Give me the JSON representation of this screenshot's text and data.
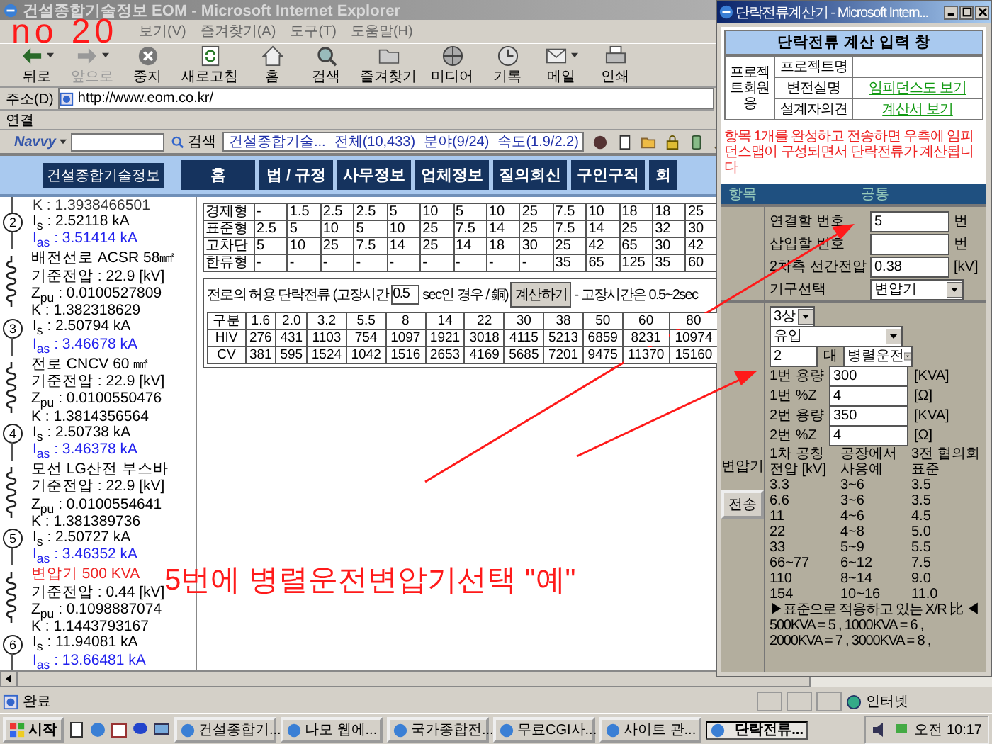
{
  "annotations": {
    "label": "no 20",
    "note": "5번에 병렬운전변압기선택 \"예\""
  },
  "browser": {
    "title": "건설종합기술정보 EOM - Microsoft Internet Explorer",
    "menu": [
      "보기(V)",
      "즐겨찾기(A)",
      "도구(T)",
      "도움말(H)"
    ],
    "toolbar": [
      {
        "label": "뒤로",
        "kind": "back",
        "disabled": false,
        "dropdown": true
      },
      {
        "label": "앞으로",
        "kind": "forward",
        "disabled": true,
        "dropdown": true
      },
      {
        "label": "중지",
        "kind": "stop",
        "disabled": false,
        "dropdown": false
      },
      {
        "label": "새로고침",
        "kind": "refresh",
        "disabled": false,
        "dropdown": false
      },
      {
        "label": "홈",
        "kind": "home",
        "disabled": false,
        "dropdown": false
      },
      {
        "label": "검색",
        "kind": "search",
        "disabled": false,
        "dropdown": false
      },
      {
        "label": "즐겨찾기",
        "kind": "favorites",
        "disabled": false,
        "dropdown": false
      },
      {
        "label": "미디어",
        "kind": "media",
        "disabled": false,
        "dropdown": false
      },
      {
        "label": "기록",
        "kind": "history",
        "disabled": false,
        "dropdown": false
      },
      {
        "label": "메일",
        "kind": "mail",
        "disabled": false,
        "dropdown": true
      },
      {
        "label": "인쇄",
        "kind": "print",
        "disabled": false,
        "dropdown": false
      }
    ],
    "address": {
      "label": "주소(D)",
      "value": "http://www.eom.co.kr/"
    },
    "links_label": "연결",
    "navvy": {
      "brand": "Navvy",
      "search_button": "검색",
      "site": "건설종합기술...",
      "stats": [
        "전체(10,433)",
        "분야(9/24)",
        "속도(1.9/2.2)"
      ]
    }
  },
  "site": {
    "logo": "건설종합기술정보",
    "nav": [
      "홈",
      "법 / 규정",
      "사무정보",
      "업체정보",
      "질의회신",
      "구인구직",
      "회"
    ]
  },
  "circuit": {
    "top_partial": "K : 1.3938466501",
    "nodes": [
      {
        "number": "2",
        "is": "I$_{s}$ : 2.52118 kA",
        "ias": "I$_{as}$ : 3.51414 kA",
        "desc": "배전선로 ACSR 58㎟",
        "desc_highlight": false,
        "voltage": "기준전압 : 22.9 [kV]",
        "zpu": "Z$_{pu}$ : 0.0100527809",
        "k": "K : 1.382318629"
      },
      {
        "number": "3",
        "is": "I$_{s}$ : 2.50794 kA",
        "ias": "I$_{as}$ : 3.46678 kA",
        "desc": "전로 CNCV 60 ㎟",
        "desc_highlight": false,
        "voltage": "기준전압 : 22.9 [kV]",
        "zpu": "Z$_{pu}$ : 0.0100550476",
        "k": "K : 1.3814356564"
      },
      {
        "number": "4",
        "is": "I$_{s}$ : 2.50738 kA",
        "ias": "I$_{as}$ : 3.46378 kA",
        "desc": "모선 LG산전 부스바",
        "desc_highlight": false,
        "voltage": "기준전압 : 22.9 [kV]",
        "zpu": "Z$_{pu}$ : 0.0100554641",
        "k": "K : 1.381389736"
      },
      {
        "number": "5",
        "is": "I$_{s}$ : 2.50727 kA",
        "ias": "I$_{as}$ : 3.46352 kA",
        "desc": "변압기 500 KVA",
        "desc_highlight": true,
        "voltage": "기준전압 : 0.44 [kV]",
        "zpu": "Z$_{pu}$ : 0.1098887074",
        "k": "K : 1.1443793167"
      },
      {
        "number": "6",
        "is": "I$_{s}$ : 11.94081 kA",
        "ias": "I$_{as}$ : 13.66481 kA"
      }
    ]
  },
  "breaker_table": {
    "rows": [
      {
        "label": "경제형",
        "values": [
          "-",
          "1.5",
          "2.5",
          "2.5",
          "5",
          "10",
          "5",
          "10",
          "25",
          "7.5",
          "10",
          "18",
          "18",
          "25"
        ]
      },
      {
        "label": "표준형",
        "values": [
          "2.5",
          "5",
          "10",
          "5",
          "10",
          "25",
          "7.5",
          "14",
          "25",
          "7.5",
          "14",
          "25",
          "32",
          "30"
        ]
      },
      {
        "label": "고차단",
        "values": [
          "5",
          "10",
          "25",
          "7.5",
          "14",
          "25",
          "14",
          "18",
          "30",
          "25",
          "42",
          "65",
          "30",
          "42"
        ]
      },
      {
        "label": "한류형",
        "values": [
          "-",
          "-",
          "-",
          "-",
          "-",
          "-",
          "-",
          "-",
          "-",
          "35",
          "65",
          "125",
          "35",
          "60"
        ]
      }
    ]
  },
  "cable": {
    "label": "전로의 허용 단락전류 (고장시간",
    "time": "0.5",
    "unit": "sec인 경우 / 銅)",
    "button": "계산하기",
    "note": "- 고장시간은 0.5~2sec",
    "columns": [
      "구분",
      "1.6",
      "2.0",
      "3.2",
      "5.5",
      "8",
      "14",
      "22",
      "30",
      "38",
      "50",
      "60",
      "80"
    ],
    "rows": [
      {
        "label": "HIV",
        "values": [
          "276",
          "431",
          "1103",
          "754",
          "1097",
          "1921",
          "3018",
          "4115",
          "5213",
          "6859",
          "8231",
          "10974"
        ]
      },
      {
        "label": "CV",
        "values": [
          "381",
          "595",
          "1524",
          "1042",
          "1516",
          "2653",
          "4169",
          "5685",
          "7201",
          "9475",
          "11370",
          "15160"
        ]
      }
    ]
  },
  "popup": {
    "title": "단락전류계산기 - Microsoft Intern...",
    "heading": "단락전류 계산 입력 창",
    "project": {
      "label": "프로젝트회원용",
      "rows": [
        {
          "label": "프로젝트명"
        },
        {
          "label": "변전실명",
          "link": "임피던스도 보기"
        },
        {
          "label": "설계자의견",
          "link": "계산서 보기"
        }
      ]
    },
    "notice": "항목 1개를 완성하고 전송하면 우측에 임피던스맵이 구성되면서 단락전류가 계산됩니다",
    "form": {
      "col_item": "항목",
      "col_common": "공통",
      "common": [
        {
          "label": "연결할 번호",
          "kind": "input",
          "value": "5",
          "unit": "번"
        },
        {
          "label": "삽입할 번호",
          "kind": "input",
          "unit": "번"
        },
        {
          "label": "2차측 선간전압",
          "kind": "input",
          "value": "0.38",
          "unit": "[kV]"
        },
        {
          "label": "기구선택",
          "kind": "select",
          "value": "변압기"
        }
      ],
      "device": {
        "label": "변압기",
        "button": "전송",
        "phase": "3상",
        "type": "유입",
        "count": "2",
        "count_unit": "대",
        "mode": "병렬운전",
        "fields": [
          {
            "label": "1번 용량",
            "value": "300",
            "unit": "[KVA]"
          },
          {
            "label": "1번 %Z",
            "value": "4",
            "unit": "[Ω]"
          },
          {
            "label": "2번 용량",
            "value": "350",
            "unit": "[KVA]"
          },
          {
            "label": "2번 %Z",
            "value": "4",
            "unit": "[Ω]"
          }
        ],
        "ref_columns": [
          "1차 공칭 전압 [kV]",
          "공장에서 사용예",
          "3전 협의회 표준"
        ],
        "ref_rows": [
          [
            "3.3",
            "3~6",
            "3.5"
          ],
          [
            "6.6",
            "3~6",
            "3.5"
          ],
          [
            "11",
            "4~6",
            "4.5"
          ],
          [
            "22",
            "4~8",
            "5.0"
          ],
          [
            "33",
            "5~9",
            "5.5"
          ],
          [
            "66~77",
            "6~12",
            "7.5"
          ],
          [
            "110",
            "8~14",
            "9.0"
          ],
          [
            "154",
            "10~16",
            "11.0"
          ]
        ],
        "xr_title": "▶표준으로 적용하고 있는 X/R 比 ◀",
        "xr_lines": [
          "500KVA = 5 , 1000KVA = 6 ,",
          "2000KVA = 7 , 3000KVA = 8 ,"
        ]
      }
    }
  },
  "status": {
    "text": "완료",
    "zone": "인터넷"
  },
  "taskbar": {
    "start": "시작",
    "tasks": [
      {
        "label": "건설종합기...",
        "selected": false
      },
      {
        "label": "나모 웹에...",
        "selected": false
      },
      {
        "label": "국가종합전...",
        "selected": false
      },
      {
        "label": "무료CGI사...",
        "selected": false
      },
      {
        "label": "사이트 관...",
        "selected": false
      },
      {
        "label": "단락전류...",
        "selected": true
      }
    ],
    "clock": "오전 10:17"
  }
}
